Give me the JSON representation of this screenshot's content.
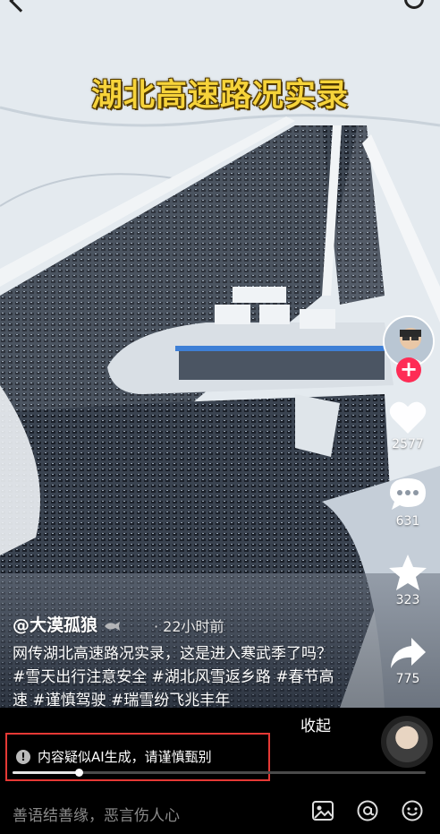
{
  "video": {
    "title": "湖北高速路况实录"
  },
  "rail": {
    "likes": "2577",
    "comments": "631",
    "favorites": "323",
    "shares": "775"
  },
  "post": {
    "author": "@大漠孤狼",
    "time": "· 22小时前",
    "caption": "网传湖北高速路况实录，这是进入寒武季了吗？#雪天出行注意安全 #湖北风雪返乡路 #春节高速 #谨慎驾驶 #瑞雪纷飞兆丰年",
    "collapse_label": "收起"
  },
  "ai_notice": {
    "text": "内容疑似AI生成，请谨慎甄别"
  },
  "progress": {
    "value": 0.16
  },
  "comment_bar": {
    "placeholder": "善语结善缘，恶言伤人心"
  },
  "colors": {
    "accent": "#fe2c55",
    "title_yellow": "#f6d33a",
    "notice_border": "#e53935"
  },
  "icons": [
    "back-icon",
    "search-icon",
    "plus-icon",
    "heart-icon",
    "comment-icon",
    "star-icon",
    "share-icon",
    "warning-icon",
    "image-icon",
    "at-icon",
    "emoji-icon"
  ]
}
